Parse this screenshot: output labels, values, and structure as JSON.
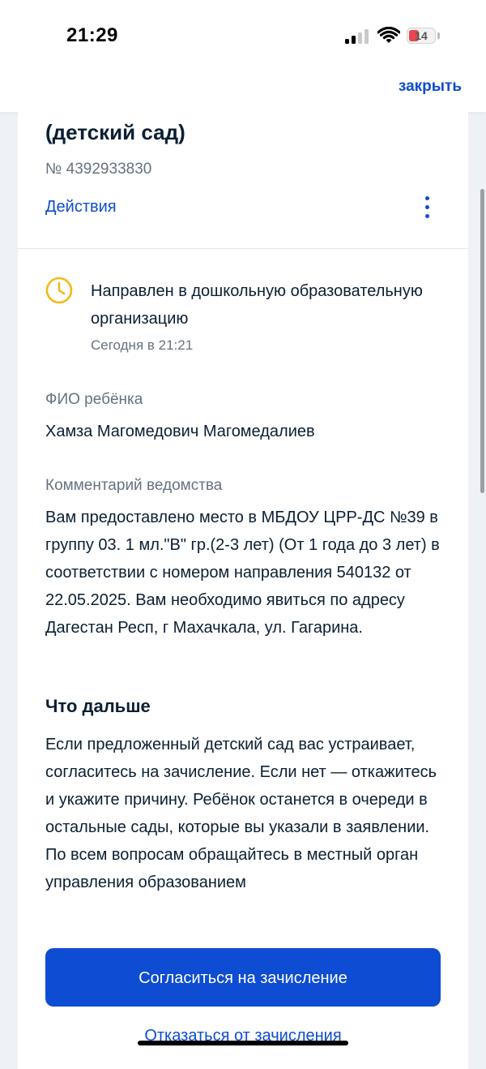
{
  "status_bar": {
    "time": "21:29",
    "battery": "14",
    "icons": [
      "signal-icon",
      "wifi-icon",
      "battery-icon"
    ]
  },
  "nav": {
    "close_label": "закрыть"
  },
  "application": {
    "title": "(детский сад)",
    "number": "№ 4392933830",
    "actions_label": "Действия",
    "menu_icon": "kebab-menu-icon"
  },
  "status": {
    "icon": "clock-icon",
    "icon_color": "#f5b81a",
    "text": "Направлен в дошкольную образовательную организацию",
    "time": "Сегодня в 21:21"
  },
  "child": {
    "label": "ФИО ребёнка",
    "value": "Хамза Магомедович Магомедалиев"
  },
  "comment": {
    "label": "Комментарий ведомства",
    "value": "Вам предоставлено место в МБДОУ ЦРР-ДС №39 в группу 03. 1 мл.\"В\" гр.(2-3 лет) (От 1 года до 3 лет) в соответствии с номером направления 540132 от 22.05.2025. Вам необходимо явиться по адресу Дагестан Респ, г Махачкала, ул. Гагарина."
  },
  "next_steps": {
    "title": "Что дальше",
    "text": "Если предложенный детский сад вас устраивает, согласитесь на зачисление. Если нет — откажитесь и укажите причину. Ребёнок останется в очереди в остальные сады, которые вы указали в заявлении. По всем вопросам обращайтесь в местный орган управления образованием"
  },
  "buttons": {
    "accept": "Согласиться на зачисление",
    "decline": "Отказаться от зачисления"
  },
  "colors": {
    "accent": "#0d4cd3",
    "text": "#0b1f33",
    "muted": "#66727f"
  }
}
